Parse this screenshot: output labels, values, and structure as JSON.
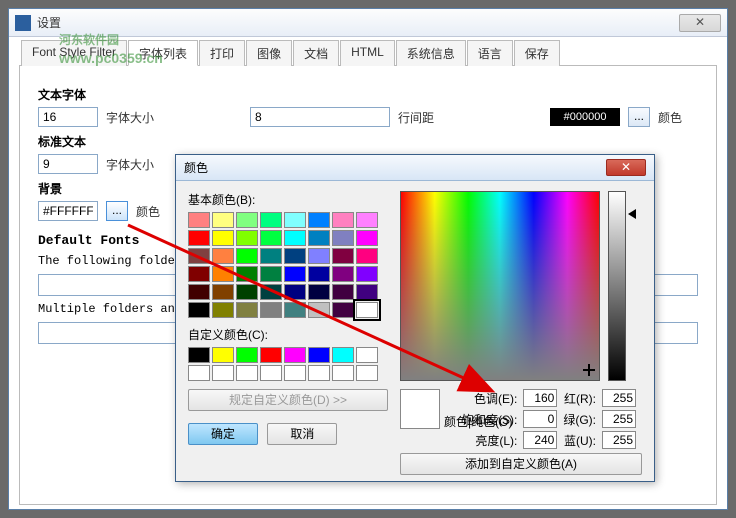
{
  "watermark": {
    "line1": "河东软件园",
    "line2": "www.pc0359.cn"
  },
  "mainWindow": {
    "title": "设置",
    "tabs": [
      "Font Style Filter",
      "字体列表",
      "打印",
      "图像",
      "文档",
      "HTML",
      "系统信息",
      "语言",
      "保存"
    ],
    "activeTab": 1
  },
  "fontList": {
    "textFont": {
      "label": "文本字体",
      "value": "16",
      "sizeLabel": "字体大小",
      "sizeValue": "8",
      "lineSpacingLabel": "行间距",
      "colorValue": "#000000",
      "colorLabel": "颜色"
    },
    "standardText": {
      "label": "标准文本",
      "value": "9",
      "sizeLabel": "字体大小"
    },
    "background": {
      "label": "背景",
      "value": "#FFFFFF",
      "colorLabel": "颜色"
    },
    "defaultFonts": {
      "title": "Default Fonts",
      "desc1": "The following folders a",
      "desc2": "Multiple folders and fo"
    }
  },
  "colorDialog": {
    "title": "颜色",
    "basicLabel": "基本颜色(B):",
    "customLabel": "自定义颜色(C):",
    "defineBtn": "规定自定义颜色(D) >>",
    "ok": "确定",
    "cancel": "取消",
    "previewLabel": "颜色|纯色(O)",
    "addBtn": "添加到自定义颜色(A)",
    "hsl": {
      "hueLabel": "色调(E):",
      "hue": "160",
      "satLabel": "饱和度(S):",
      "sat": "0",
      "lumLabel": "亮度(L):",
      "lum": "240"
    },
    "rgb": {
      "rLabel": "红(R):",
      "r": "255",
      "gLabel": "绿(G):",
      "g": "255",
      "bLabel": "蓝(U):",
      "b": "255"
    },
    "basicColors": [
      "#ff8080",
      "#ffff80",
      "#80ff80",
      "#00ff80",
      "#80ffff",
      "#0080ff",
      "#ff80c0",
      "#ff80ff",
      "#ff0000",
      "#ffff00",
      "#80ff00",
      "#00ff40",
      "#00ffff",
      "#0080c0",
      "#8080c0",
      "#ff00ff",
      "#804040",
      "#ff8040",
      "#00ff00",
      "#008080",
      "#004080",
      "#8080ff",
      "#800040",
      "#ff0080",
      "#800000",
      "#ff8000",
      "#008000",
      "#008040",
      "#0000ff",
      "#0000a0",
      "#800080",
      "#8000ff",
      "#400000",
      "#804000",
      "#004000",
      "#004040",
      "#000080",
      "#000040",
      "#400040",
      "#400080",
      "#000000",
      "#808000",
      "#808040",
      "#808080",
      "#408080",
      "#c0c0c0",
      "#400040",
      "#ffffff"
    ],
    "customColors": [
      "#000000",
      "#ffff00",
      "#00ff00",
      "#ff0000",
      "#ff00ff",
      "#0000ff",
      "#00ffff",
      "#ffffff",
      "#ffffff",
      "#ffffff",
      "#ffffff",
      "#ffffff",
      "#ffffff",
      "#ffffff",
      "#ffffff",
      "#ffffff"
    ]
  }
}
